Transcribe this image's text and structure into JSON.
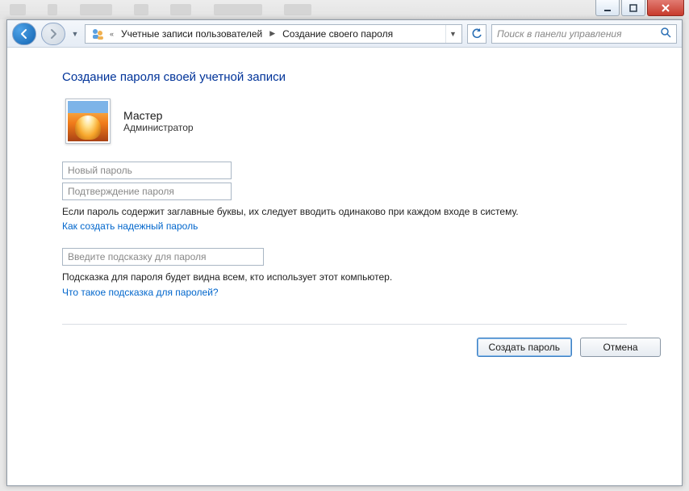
{
  "breadcrumb": {
    "seg1": "Учетные записи пользователей",
    "seg2": "Создание своего пароля"
  },
  "search": {
    "placeholder": "Поиск в панели управления"
  },
  "page": {
    "title": "Создание пароля своей учетной записи"
  },
  "user": {
    "name": "Мастер",
    "role": "Администратор"
  },
  "fields": {
    "new_password_ph": "Новый пароль",
    "confirm_password_ph": "Подтверждение пароля",
    "hint_ph": "Введите подсказку для пароля"
  },
  "text": {
    "caps_note": "Если пароль содержит заглавные буквы, их следует вводить одинаково при каждом входе в систему.",
    "strong_link": "Как создать надежный пароль",
    "hint_note": "Подсказка для пароля будет видна всем, кто использует этот компьютер.",
    "hint_link": "Что такое подсказка для паролей?"
  },
  "buttons": {
    "create": "Создать пароль",
    "cancel": "Отмена"
  }
}
